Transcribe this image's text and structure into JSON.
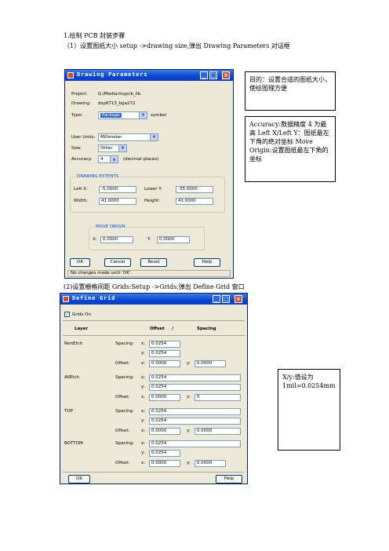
{
  "heading": "1.绘制 PCB 封装步骤",
  "step1": "（1）设置图纸大小 setup ->drawing size,弹出 Drawing Parameters 对话框",
  "step2": "(2)设置栅格间距 Grids:Setup ->Grids,弹出 Define Grid 窗口",
  "notes": {
    "purpose": "目的：设置合适的图纸大小，使绘图理方便",
    "accuracy": "Accuracy:数据精度 4 为最高 Left X/Left Y：图纸最左下角的绝对坐标 Move Origin:设置图纸最左下角的坐标",
    "grid": "X/y:值设为 1mil=0.0254mm"
  },
  "drawing_parameters": {
    "title": "Drawing Parameters",
    "project_label": "Project:",
    "project_value": "G:/Media/mypcb_lib",
    "drawing_label": "Drawing:",
    "drawing_value": "dsp6713_bga272",
    "type_label": "Type:",
    "type_value": "Package",
    "type_suffix": "symbol",
    "user_units_label": "User Units:",
    "user_units_value": "Millimeter",
    "size_label": "Size:",
    "size_value": "Other",
    "accuracy_label": "Accuracy:",
    "accuracy_value": "4",
    "accuracy_suffix": "(decimal places)",
    "extents_title": "DRAWING EXTENTS",
    "left_x_label": "Left X:",
    "left_x_value": "-5.0000",
    "lower_y_label": "Lower Y:",
    "lower_y_value": "-35.0000",
    "width_label": "Width:",
    "width_value": "41.0000",
    "height_label": "Height:",
    "height_value": "41.0000",
    "move_title": "MOVE ORIGIN",
    "x_label": "X:",
    "x_value": "0.0000",
    "y_label": "Y:",
    "y_value": "0.0000",
    "ok": "OK",
    "cancel": "Cancel",
    "reset": "Reset",
    "help": "Help",
    "status": "No changes made until 'OK'."
  },
  "define_grid": {
    "title": "Define Grid",
    "grids_on": "Grids On",
    "col_layer": "Layer",
    "col_offset": "Offset",
    "col_slash": "/",
    "col_spacing": "Spacing",
    "spacing_label": "Spacing:",
    "offset_label": "Offset:",
    "x": "x:",
    "y": "y:",
    "layers": [
      {
        "name": "NonEtch",
        "sx": "0.0254",
        "sy": "0.0254",
        "ox": "0.0000",
        "oy": "0.0000"
      },
      {
        "name": "AllEtch",
        "sx": "0.0254",
        "sy": "0.0254",
        "ox": "0.0000",
        "oy": "0"
      },
      {
        "name": "TOP",
        "sx": "0.0254",
        "sy": "0.0254",
        "ox": "0.0000",
        "oy": "0.0000"
      },
      {
        "name": "BOTTOM",
        "sx": "0.0254",
        "sy": "0.0254",
        "ox": "0.0000",
        "oy": "0.0000"
      }
    ],
    "ok": "OK",
    "help": "Help"
  }
}
